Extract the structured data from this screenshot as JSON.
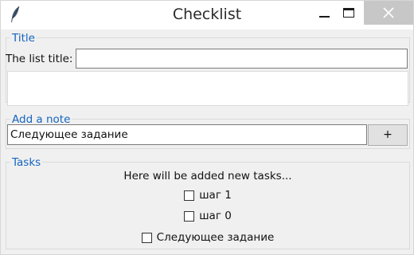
{
  "window": {
    "title": "Checklist",
    "icon": "feather-icon"
  },
  "title_section": {
    "legend": "Title",
    "label": "The list title:",
    "title_value": "",
    "body_value": ""
  },
  "note_section": {
    "legend": "Add a note",
    "note_value": "Следующее задание",
    "add_label": "+"
  },
  "tasks_section": {
    "legend": "Tasks",
    "hint": "Here will be added new tasks...",
    "tasks": [
      {
        "label": "шаг 1",
        "checked": false
      },
      {
        "label": "шаг 0",
        "checked": false
      },
      {
        "label": "Следующее задание",
        "checked": false
      }
    ]
  },
  "colors": {
    "accent": "#1565c0",
    "background": "#f0f0f0"
  }
}
